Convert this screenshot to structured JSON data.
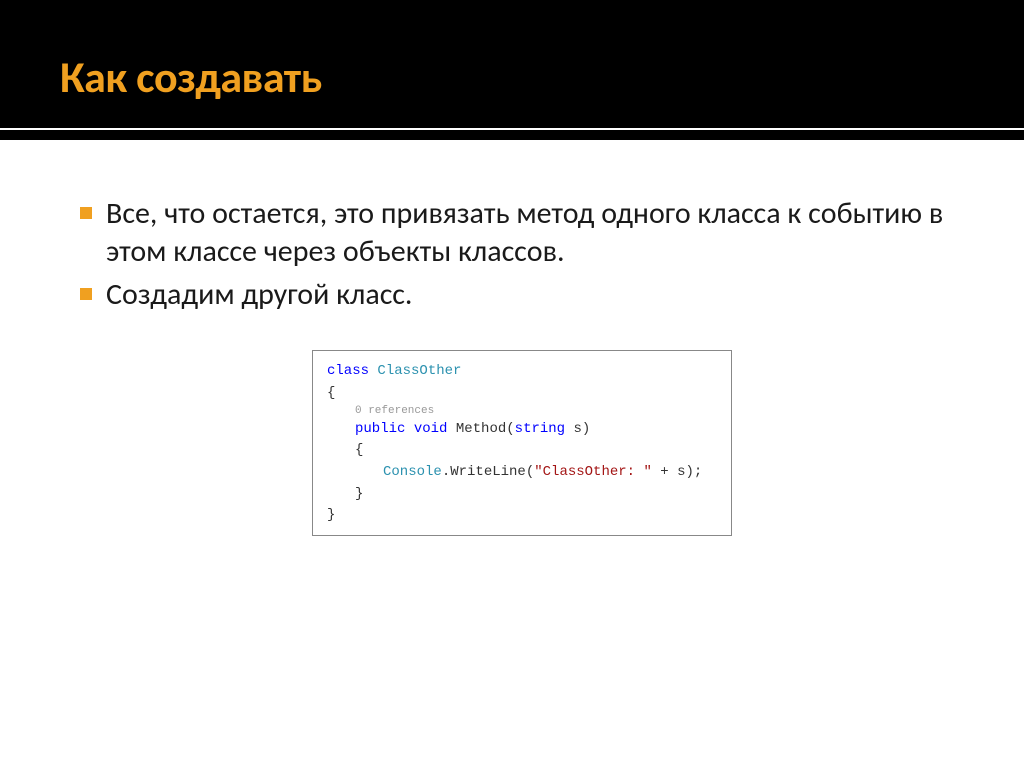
{
  "title": "Как создавать",
  "bullets": [
    "Все, что остается, это привязать метод одного класса к событию в этом классе через объекты классов.",
    "Создадим другой класс."
  ],
  "code": {
    "keyword_class": "class",
    "class_name": "ClassOther",
    "brace_open": "{",
    "references_hint": "0 references",
    "keyword_public": "public",
    "keyword_void": "void",
    "method_name": "Method",
    "param_type": "string",
    "param_name": "s",
    "method_open_paren": "(",
    "method_close_paren": ")",
    "body_open": "{",
    "console_class": "Console",
    "writeline": ".WriteLine(",
    "string_literal": "\"ClassOther: \"",
    "concat": " + s);",
    "body_close": "}",
    "brace_close": "}"
  }
}
